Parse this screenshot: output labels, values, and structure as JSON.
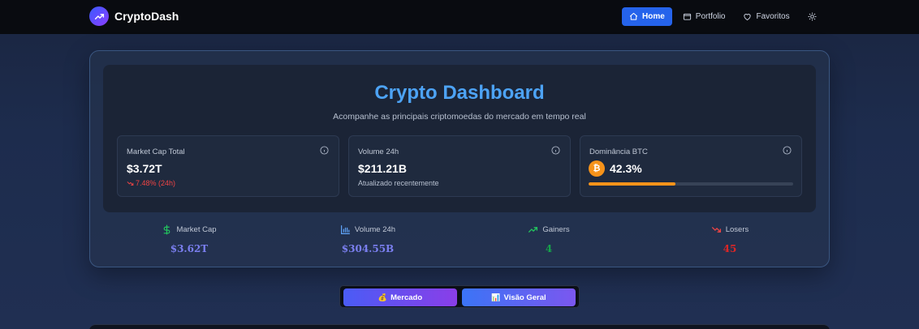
{
  "nav": {
    "brand": "CryptoDash",
    "links": [
      {
        "label": "Home",
        "icon": "home-icon",
        "active": true
      },
      {
        "label": "Portfolio",
        "icon": "wallet-icon",
        "active": false
      },
      {
        "label": "Favoritos",
        "icon": "heart-icon",
        "active": false
      }
    ],
    "theme_toggle_icon": "sun-icon"
  },
  "hero": {
    "title": "Crypto Dashboard",
    "subtitle": "Acompanhe as principais criptomoedas do mercado em tempo real"
  },
  "stats": {
    "market_cap": {
      "label": "Market Cap Total",
      "value": "$3.72T",
      "change": "7.48% (24h)"
    },
    "volume": {
      "label": "Volume 24h",
      "value": "$211.21B",
      "note": "Atualizado recentemente"
    },
    "btc_dominance": {
      "label": "Dominância BTC",
      "value": "42.3%",
      "fraction": 0.423,
      "coin_symbol": "₿"
    }
  },
  "summary": [
    {
      "label": "Market Cap",
      "value": "$3.62T",
      "icon": "dollar-icon",
      "color": "#7b7ff0"
    },
    {
      "label": "Volume 24h",
      "value": "$304.55B",
      "icon": "bar-chart-icon",
      "color": "#7b7ff0"
    },
    {
      "label": "Gainers",
      "value": "4",
      "icon": "trending-up-icon",
      "color": "#16a34a"
    },
    {
      "label": "Losers",
      "value": "45",
      "icon": "trending-down-icon",
      "color": "#dc2626"
    }
  ],
  "tabs": [
    {
      "label": "Mercado",
      "emoji": "💰"
    },
    {
      "label": "Visão Geral",
      "emoji": "📊"
    }
  ],
  "colors": {
    "accent": "#2563eb",
    "title": "#4da3f5",
    "btc": "#f7931a",
    "negative": "#ef4444"
  }
}
